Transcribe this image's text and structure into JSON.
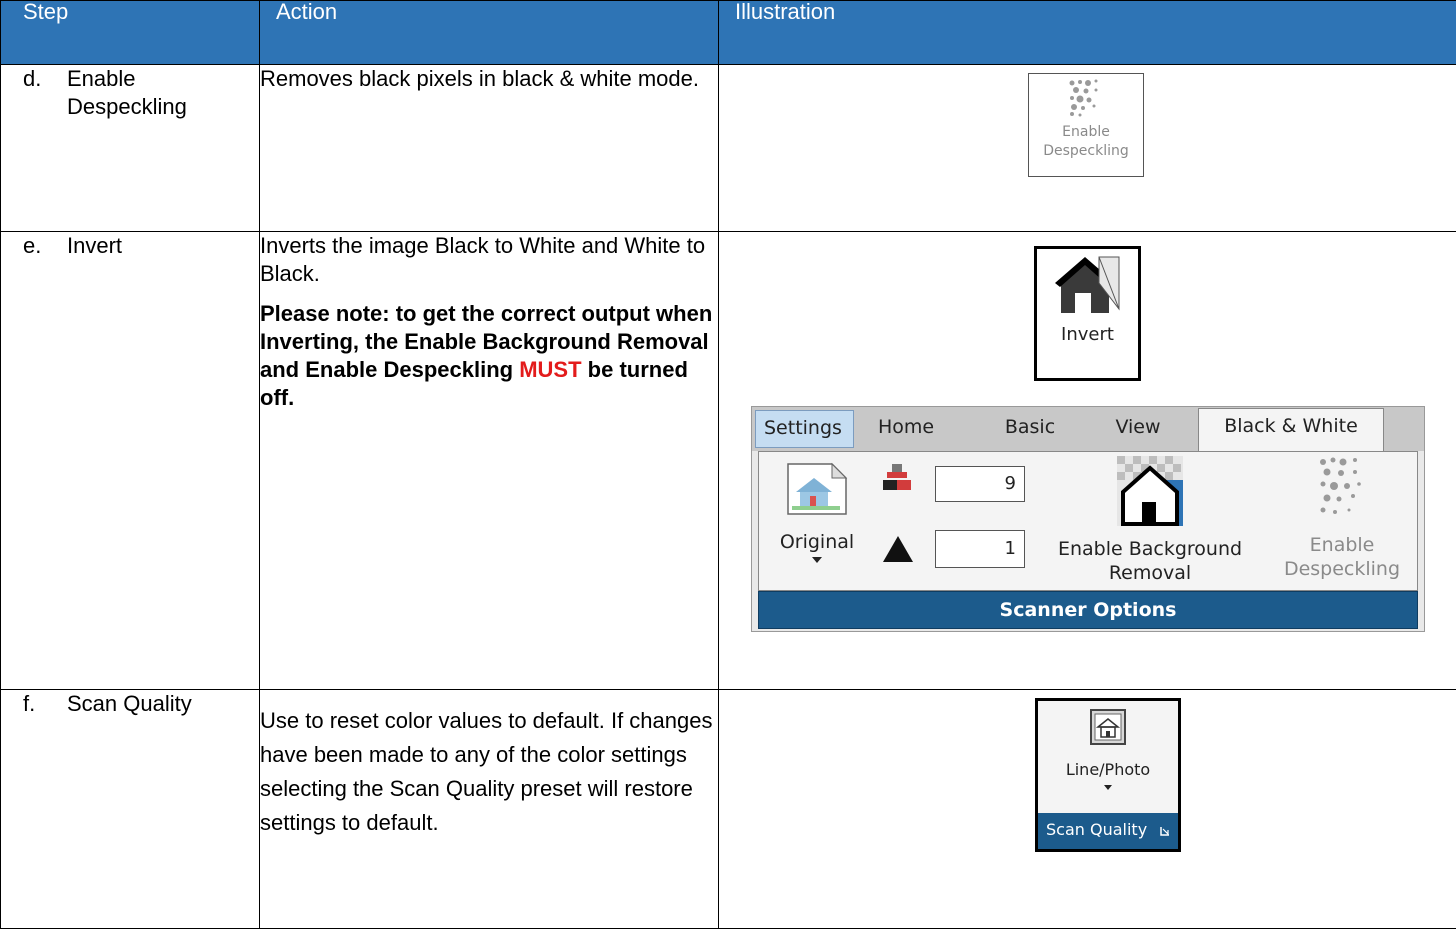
{
  "header": {
    "step": "Step",
    "action": "Action",
    "illustration": "Illustration"
  },
  "rows": [
    {
      "letter": "d.",
      "step": "Enable Despeckling",
      "action": "Removes black pixels in black & white mode.",
      "illustration": {
        "label_line1": "Enable",
        "label_line2": "Despeckling",
        "icon": "despeckle-icon"
      }
    },
    {
      "letter": "e.",
      "step": "Invert",
      "action": "Inverts the image Black to White and White to Black.",
      "note_before": "Please note: to get the correct output when Inverting, the Enable Background Removal and Enable Despeckling",
      "note_must": "MUST",
      "note_after": "be turned off.",
      "invert_button": {
        "label": "Invert",
        "icon": "invert-house-icon"
      },
      "ribbon": {
        "tabs": [
          "Settings",
          "Home",
          "Basic",
          "View",
          "Black & White"
        ],
        "active_tab": "Black & White",
        "original_label": "Original",
        "threshold_value": "9",
        "contrast_value": "1",
        "bg_removal_line1": "Enable Background",
        "bg_removal_line2": "Removal",
        "despeckle_line1": "Enable",
        "despeckle_line2": "Despeckling",
        "group_label": "Scanner Options",
        "group_color": "#1c5b8c"
      }
    },
    {
      "letter": "f.",
      "step": "Scan Quality",
      "action": "Use to reset color values to default. If changes have been made to any of the color settings selecting the Scan Quality preset will restore settings to default.",
      "scan_widget": {
        "label": "Line/Photo",
        "group_label": "Scan Quality",
        "icon": "line-photo-icon"
      }
    }
  ],
  "colors": {
    "header_bg": "#2e74b5",
    "must": "#e31b1b"
  }
}
